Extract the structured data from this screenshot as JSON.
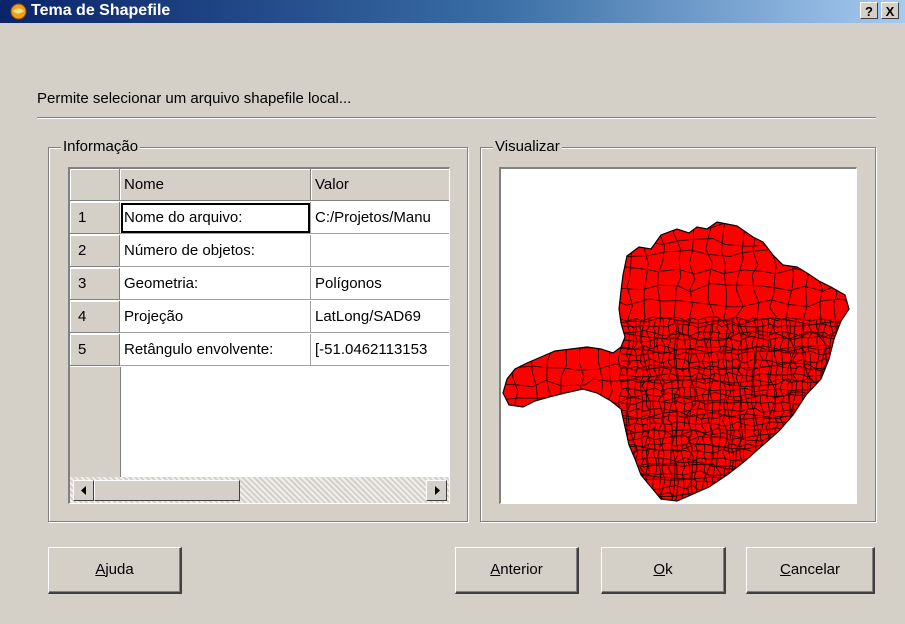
{
  "window": {
    "title": "Tema de Shapefile",
    "help_button": "?",
    "close_button": "X"
  },
  "description": "Permite selecionar um arquivo shapefile local...",
  "info_group": {
    "legend": "Informação",
    "columns": [
      "Nome",
      "Valor"
    ],
    "rows": [
      {
        "index": "1",
        "name": "Nome do arquivo:",
        "value": "C:/Projetos/Manu"
      },
      {
        "index": "2",
        "name": "Número de objetos:",
        "value": ""
      },
      {
        "index": "3",
        "name": "Geometria:",
        "value": "Polígonos"
      },
      {
        "index": "4",
        "name": "Projeção",
        "value": "LatLong/SAD69"
      },
      {
        "index": "5",
        "name": "Retângulo envolvente:",
        "value": "[-51.0462113153"
      }
    ]
  },
  "preview_group": {
    "legend": "Visualizar",
    "fill_color": "#ff0000",
    "stroke_color": "#200000"
  },
  "buttons": {
    "help": {
      "mnemonic": "A",
      "rest": "juda"
    },
    "previous": {
      "mnemonic": "A",
      "rest": "nterior"
    },
    "ok": {
      "mnemonic": "O",
      "rest": "k"
    },
    "cancel": {
      "mnemonic": "C",
      "rest": "ancelar"
    }
  }
}
